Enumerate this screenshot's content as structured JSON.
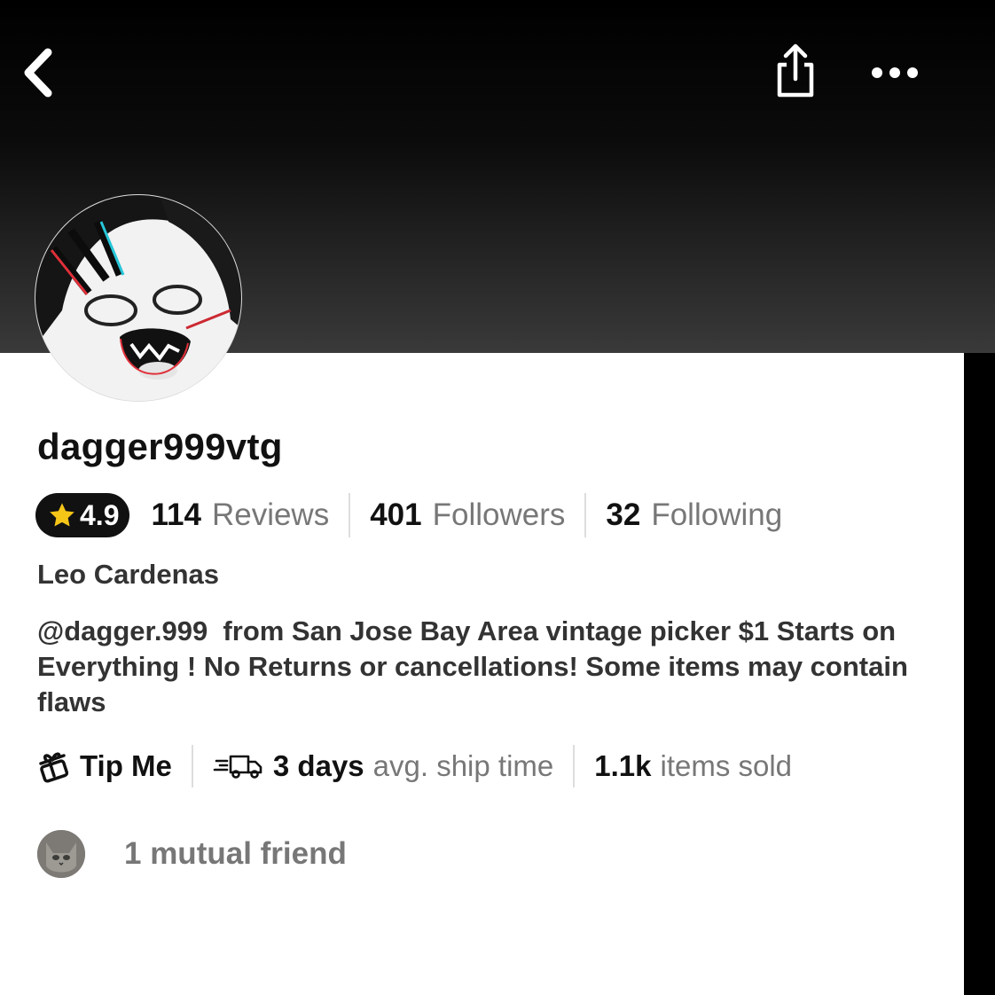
{
  "profile": {
    "username": "dagger999vtg",
    "rating": "4.9",
    "reviews": {
      "count": "114",
      "label": "Reviews"
    },
    "followers": {
      "count": "401",
      "label": "Followers"
    },
    "following": {
      "count": "32",
      "label": "Following"
    },
    "real_name": "Leo Cardenas",
    "bio": "@dagger.999  from San Jose Bay Area vintage picker $1 Starts on Everything ! No Returns or cancellations! Some items may contain flaws"
  },
  "info": {
    "tip_label": "Tip Me",
    "ship_value": "3 days",
    "ship_label": "avg. ship time",
    "sold_value": "1.1k",
    "sold_label": "items sold"
  },
  "mutual": {
    "text": "1 mutual friend"
  },
  "icons": {
    "back": "chevron-left-icon",
    "share": "share-icon",
    "more": "more-horizontal-icon",
    "star": "star-icon",
    "tip": "gift-icon",
    "ship": "delivery-truck-icon"
  },
  "colors": {
    "header_bg": "#000000",
    "card_bg": "#ffffff",
    "text_primary": "#111111",
    "text_secondary": "#777777",
    "star": "#f5c518"
  }
}
